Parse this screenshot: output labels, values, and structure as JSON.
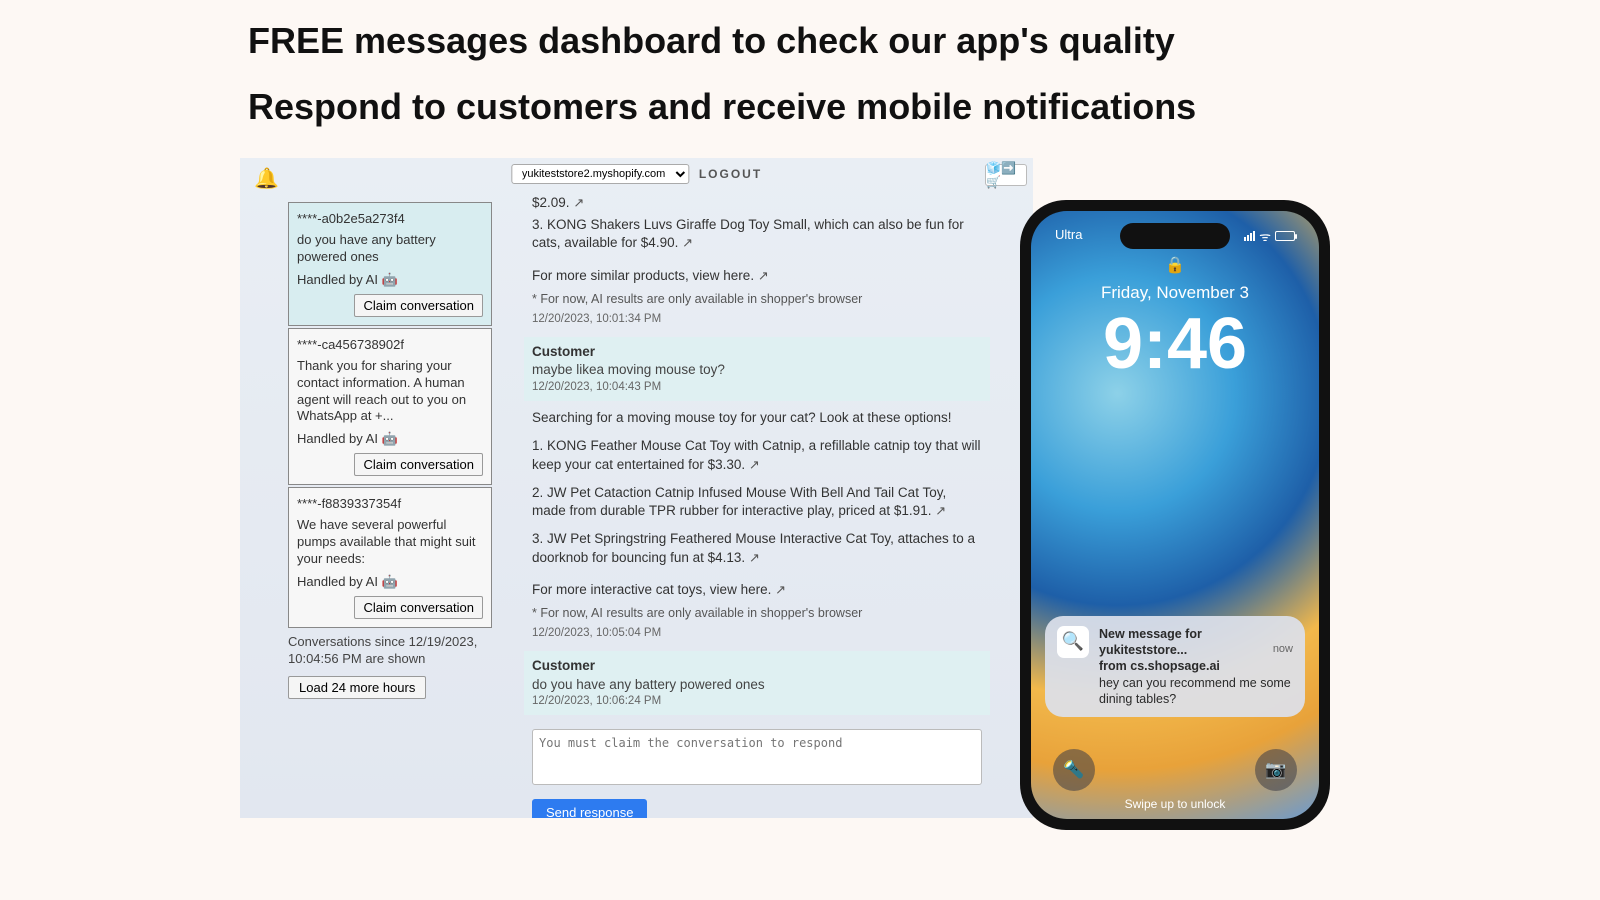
{
  "headline1": "FREE messages dashboard to check our app's quality",
  "headline2": "Respond to customers and receive mobile notifications",
  "dashboard": {
    "store_select": "yukiteststore2.myshopify.com",
    "logout": "LOGOUT",
    "cart_toggle": "🧊➡️🛒",
    "conversations": [
      {
        "id": "****-a0b2e5a273f4",
        "snippet": "do you have any battery powered ones",
        "handled": "Handled by AI 🤖",
        "claim": "Claim conversation"
      },
      {
        "id": "****-ca456738902f",
        "snippet": "Thank you for sharing your contact information. A human agent will reach out to you on WhatsApp at +...",
        "handled": "Handled by AI 🤖",
        "claim": "Claim conversation"
      },
      {
        "id": "****-f8839337354f",
        "snippet": "We have several powerful pumps available that might suit your needs:",
        "handled": "Handled by AI 🤖",
        "claim": "Claim conversation"
      }
    ],
    "since_text": "Conversations since 12/19/2023, 10:04:56 PM are shown",
    "load_more": "Load 24 more hours",
    "thread": {
      "line_price": "$2.09.",
      "item3": " 3. KONG Shakers Luvs Giraffe Dog Toy Small, which can also be fun for cats, available for $4.90.",
      "more1": "For more similar products, view here.",
      "note1": "  * For now, AI results are only available in shopper's browser",
      "ts1": "12/20/2023, 10:01:34 PM",
      "cust1_label": "Customer",
      "cust1_msg": "maybe likea moving mouse toy?",
      "cust1_ts": "12/20/2023, 10:04:43 PM",
      "search_intro": "Searching for a moving mouse toy for your cat? Look at these options!",
      "opt1": " 1. KONG Feather Mouse Cat Toy with Catnip, a refillable catnip toy that will keep your cat entertained for $3.30.",
      "opt2": " 2. JW Pet Cataction Catnip Infused Mouse With Bell And Tail Cat Toy, made from durable TPR rubber for interactive play, priced at $1.91.",
      "opt3": " 3. JW Pet Springstring Feathered Mouse Interactive Cat Toy, attaches to a doorknob for bouncing fun at $4.13.",
      "more2": "For more interactive cat toys, view here.",
      "note2": "  * For now, AI results are only available in shopper's browser",
      "ts2": "12/20/2023, 10:05:04 PM",
      "cust2_label": "Customer",
      "cust2_msg": "do you have any battery powered ones",
      "cust2_ts": "12/20/2023, 10:06:24 PM",
      "reply_placeholder": "You must claim the conversation to respond",
      "send": "Send response"
    }
  },
  "phone": {
    "carrier": "Ultra",
    "date": "Friday, November 3",
    "time": "9:46",
    "notif_title": "New message for yukiteststore...",
    "notif_now": "now",
    "notif_from": "from cs.shopsage.ai",
    "notif_body": "hey can you recommend me some dining tables?",
    "swipe": "Swipe up to unlock"
  }
}
